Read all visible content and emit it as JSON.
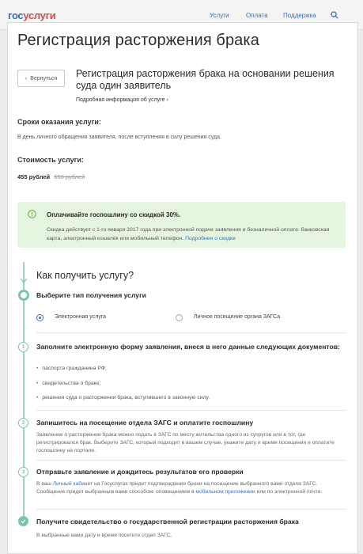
{
  "header": {
    "logo_part1": "гос",
    "logo_part2": "услуги",
    "nav": [
      "Услуги",
      "Оплата",
      "Поддержка"
    ],
    "search_icon": "search-icon"
  },
  "page": {
    "title": "Регистрация расторжения брака",
    "back_label": "Вернуться",
    "service_title": "Регистрация расторжения брака на основании решения суда один заявитель",
    "more_info": "Подробная информация об услуге"
  },
  "terms": {
    "label": "Сроки оказания услуги:",
    "text": "В день личного обращения заявителя, после вступления в силу решения суда."
  },
  "cost": {
    "label": "Стоимость услуги:",
    "price": "455 рублей",
    "old_price": "650 рублей"
  },
  "promo": {
    "title": "Оплачивайте госпошлину со скидкой 30%.",
    "text": "Скидка действует с 1-го января 2017 года при электронной подаче заявления и безналичной оплате: банковская карта, электронный кошелёк или мобильный телефон.",
    "link": "Подробнее о скидке"
  },
  "how": {
    "title": "Как получить услугу?",
    "step0_title": "Выберите тип получения услуги",
    "option_electronic": "Электронная услуга",
    "option_personal": "Личное посещение органа ЗАГСа",
    "step1_num": "1",
    "step1_title": "Заполните электронную форму заявления, внеся в него данные следующих документов:",
    "docs": [
      "паспорта гражданина РФ;",
      "свидетельства о браке;",
      "решения суда о расторжении брака, вступившего в законную силу."
    ],
    "step2_num": "2",
    "step2_title": "Запишитесь на посещение отдела ЗАГС и оплатите госпошлину",
    "step2_text": "Заявление о расторжении брака можно подать в ЗАГС по месту жительства одного из супругов или в тот, где регистрировался брак. Выберите ЗАГС, который подходит в вашем случае, укажите дату и время посещения и оплатите госпошлину на портале.",
    "step3_num": "3",
    "step3_title": "Отправьте заявление и дождитесь результатов его проверки",
    "step3_text_a": "В ваш",
    "step3_link1": "Личный кабинет",
    "step3_text_b": "на Госуслугах придет подтверждение брони на посещение выбранного вами отдела ЗАГС. Сообщение придет выбранным вами способом: оповещением в",
    "step3_link2": "мобильном приложении",
    "step3_text_c": "или по электронной почте.",
    "step4_title": "Получите свидетельство о государственной регистрации расторжения брака",
    "step4_text": "В выбранные вами дату и время посетите отдел ЗАГС."
  },
  "colors": {
    "brand_blue": "#3b6fb6",
    "brand_red": "#d24b4b",
    "accent_green": "#7cc4a6",
    "promo_bg": "#e6f5e0"
  }
}
